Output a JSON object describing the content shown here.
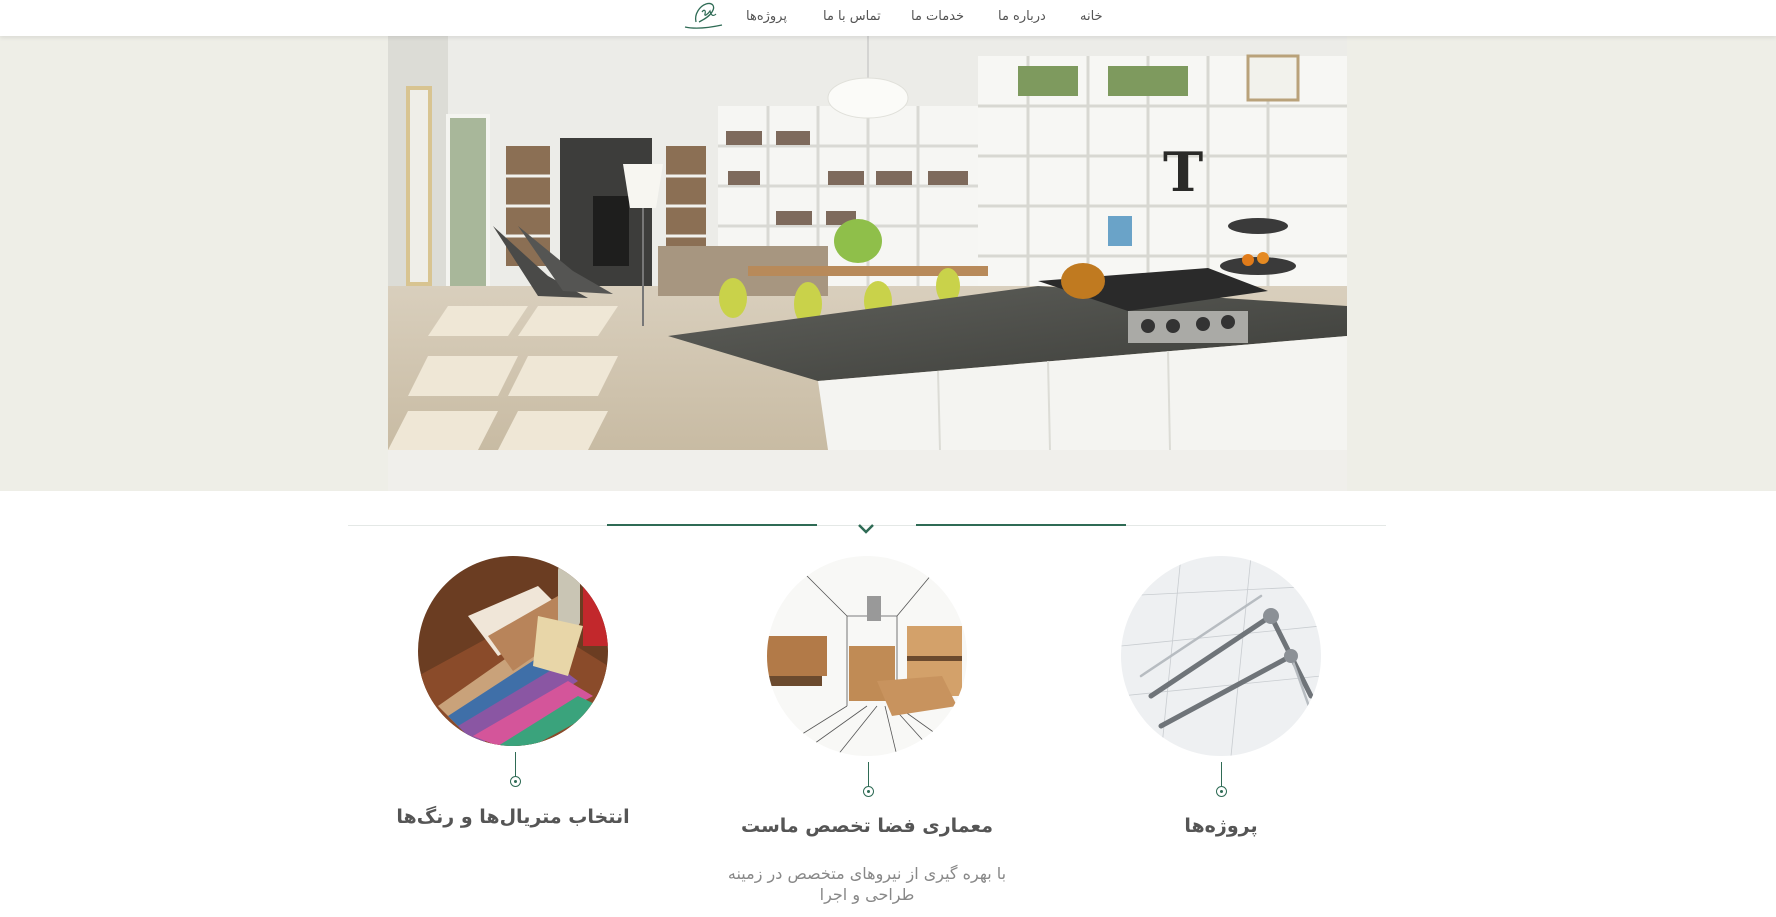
{
  "nav": {
    "items": [
      {
        "label": "خانه"
      },
      {
        "label": "درباره ما"
      },
      {
        "label": "خدمات ما"
      },
      {
        "label": "تماس با ما"
      },
      {
        "label": "پروژه‌ها"
      }
    ],
    "logo_icon": "signature-logo-icon"
  },
  "hero": {
    "image": "modern-kitchen-living-room-photo"
  },
  "divider": {
    "icon": "chevron-down-icon"
  },
  "features": [
    {
      "title": "انتخاب متریال‌ها و رنگ‌ها",
      "image": "material-swatches-photo"
    },
    {
      "title": "معماری فضا تخصص ماست",
      "image": "interior-sketch-photo",
      "description": "با بهره گیری از نیروهای متخصص در زمینه طراحی و اجرا"
    },
    {
      "title": "پروژه‌ها",
      "image": "drafting-compass-photo"
    }
  ],
  "colors": {
    "accent": "#2f6b55",
    "hero_background": "#eeeee7",
    "text": "#555555"
  }
}
